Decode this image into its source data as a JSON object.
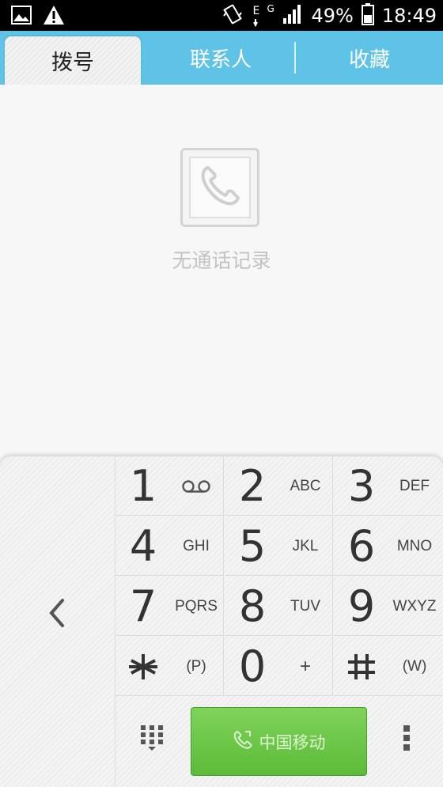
{
  "status_bar": {
    "battery_percent": "49%",
    "time": "18:49",
    "network_type": "G",
    "data_indicator": "E",
    "icons": [
      "image-notification-icon",
      "warning-icon",
      "vibrate-icon",
      "signal-icon",
      "battery-icon"
    ]
  },
  "tabs": [
    {
      "label": "拨号",
      "selected": true
    },
    {
      "label": "联系人",
      "selected": false
    },
    {
      "label": "收藏",
      "selected": false
    }
  ],
  "call_log": {
    "empty_text": "无通话记录",
    "icon": "phone-icon"
  },
  "keypad": {
    "keys": [
      {
        "digit": "1",
        "letters": "",
        "icon": "voicemail-icon"
      },
      {
        "digit": "2",
        "letters": "ABC"
      },
      {
        "digit": "3",
        "letters": "DEF"
      },
      {
        "digit": "4",
        "letters": "GHI"
      },
      {
        "digit": "5",
        "letters": "JKL"
      },
      {
        "digit": "6",
        "letters": "MNO"
      },
      {
        "digit": "7",
        "letters": "PQRS"
      },
      {
        "digit": "8",
        "letters": "TUV"
      },
      {
        "digit": "9",
        "letters": "WXYZ"
      },
      {
        "digit": "*",
        "letters": "(P)"
      },
      {
        "digit": "0",
        "letters": "+"
      },
      {
        "digit": "#",
        "letters": "(W)"
      }
    ],
    "call_button_label": "中国移动",
    "icons": [
      "collapse-icon",
      "dialpad-icon",
      "call-icon",
      "more-menu-icon"
    ]
  },
  "colors": {
    "tab_bar": "#5ec3e6",
    "call_button": "#6cc749",
    "empty_text": "#c2c2c2"
  }
}
